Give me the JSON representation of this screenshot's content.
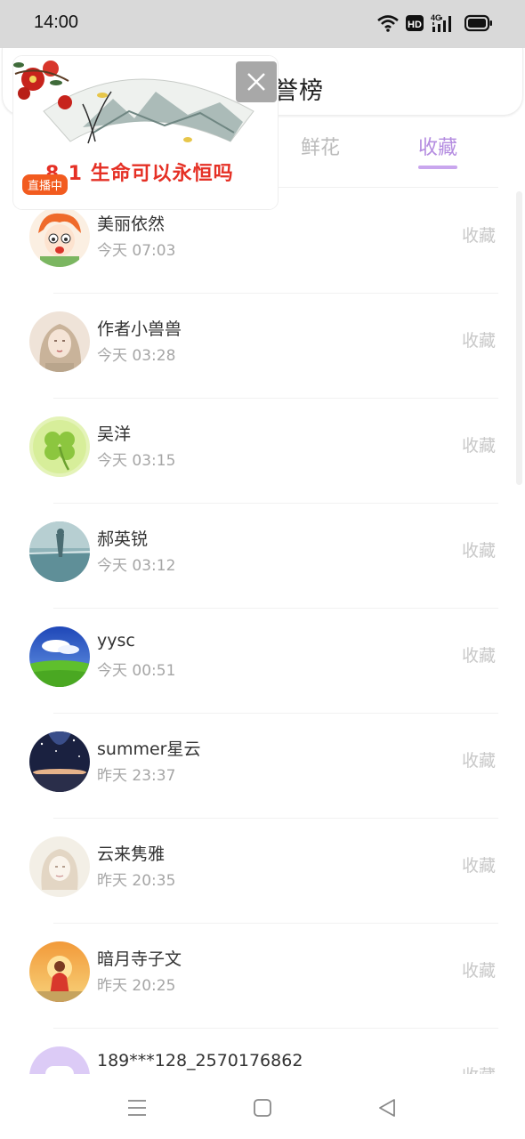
{
  "status_bar": {
    "time": "14:00",
    "hd_label": "HD",
    "net_label": "4G"
  },
  "header": {
    "title": "誉榜"
  },
  "tabs": [
    {
      "label": "鲜花",
      "active": false
    },
    {
      "label": "收藏",
      "active": true
    }
  ],
  "accent_color": "#b48ce0",
  "live_widget": {
    "title": "8.1  生命可以永恒吗",
    "badge": "直播中"
  },
  "list": [
    {
      "name": "美丽依然",
      "time": "今天 07:03",
      "action": "收藏"
    },
    {
      "name": "作者小兽兽",
      "time": "今天 03:28",
      "action": "收藏"
    },
    {
      "name": "吴洋",
      "time": "今天 03:15",
      "action": "收藏"
    },
    {
      "name": "郝英锐",
      "time": "今天 03:12",
      "action": "收藏"
    },
    {
      "name": "yysc",
      "time": "今天 00:51",
      "action": "收藏"
    },
    {
      "name": "summer星云",
      "time": "昨天 23:37",
      "action": "收藏"
    },
    {
      "name": "云来隽雅",
      "time": "昨天 20:35",
      "action": "收藏"
    },
    {
      "name": "暗月寺子文",
      "time": "昨天 20:25",
      "action": "收藏"
    },
    {
      "name": "189***128_2570176862",
      "time": "",
      "action": "收藏"
    }
  ],
  "nav": {
    "menu_icon": "menu-icon",
    "home_icon": "home-square-icon",
    "back_icon": "back-triangle-icon"
  }
}
